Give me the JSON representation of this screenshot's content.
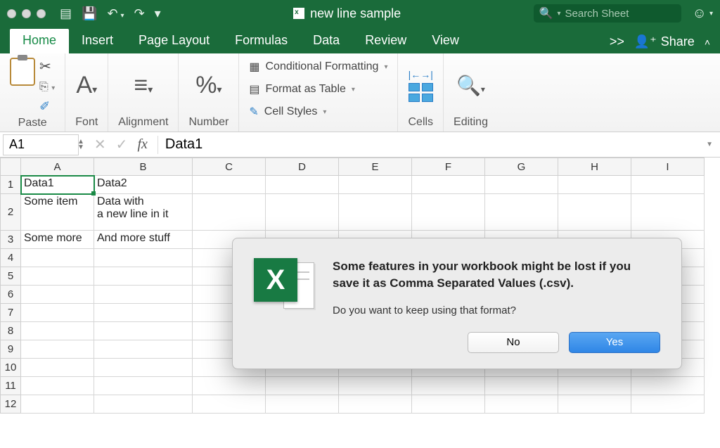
{
  "titlebar": {
    "doc_title": "new line sample",
    "search_placeholder": "Search Sheet"
  },
  "tabs": {
    "items": [
      "Home",
      "Insert",
      "Page Layout",
      "Formulas",
      "Data",
      "Review",
      "View"
    ],
    "more_glyph": ">>",
    "share_label": "Share"
  },
  "ribbon": {
    "paste_label": "Paste",
    "font_label": "Font",
    "alignment_label": "Alignment",
    "number_label": "Number",
    "conditional_formatting_label": "Conditional Formatting",
    "format_as_table_label": "Format as Table",
    "cell_styles_label": "Cell Styles",
    "cells_label": "Cells",
    "editing_label": "Editing"
  },
  "formula_bar": {
    "name_box": "A1",
    "fx_label": "fx",
    "formula_value": "Data1"
  },
  "grid": {
    "columns": [
      "A",
      "B",
      "C",
      "D",
      "E",
      "F",
      "G",
      "H",
      "I"
    ],
    "rows": [
      {
        "num": "1",
        "cells": [
          "Data1",
          "Data2"
        ]
      },
      {
        "num": "2",
        "cells": [
          "Some item",
          "Data with\na new line in it"
        ],
        "tall": true
      },
      {
        "num": "3",
        "cells": [
          "Some more",
          "And more stuff"
        ]
      },
      {
        "num": "4",
        "cells": [
          "",
          ""
        ]
      },
      {
        "num": "5",
        "cells": [
          "",
          ""
        ]
      },
      {
        "num": "6",
        "cells": [
          "",
          ""
        ]
      },
      {
        "num": "7",
        "cells": [
          "",
          ""
        ]
      },
      {
        "num": "8",
        "cells": [
          "",
          ""
        ]
      },
      {
        "num": "9",
        "cells": [
          "",
          ""
        ]
      },
      {
        "num": "10",
        "cells": [
          "",
          ""
        ]
      },
      {
        "num": "11",
        "cells": [
          "",
          ""
        ]
      },
      {
        "num": "12",
        "cells": [
          "",
          ""
        ]
      }
    ],
    "selected": "A1"
  },
  "dialog": {
    "title": "Some features in your workbook might be lost if you save it as Comma Separated Values (.csv).",
    "message": "Do you want to keep using that format?",
    "no_label": "No",
    "yes_label": "Yes"
  }
}
